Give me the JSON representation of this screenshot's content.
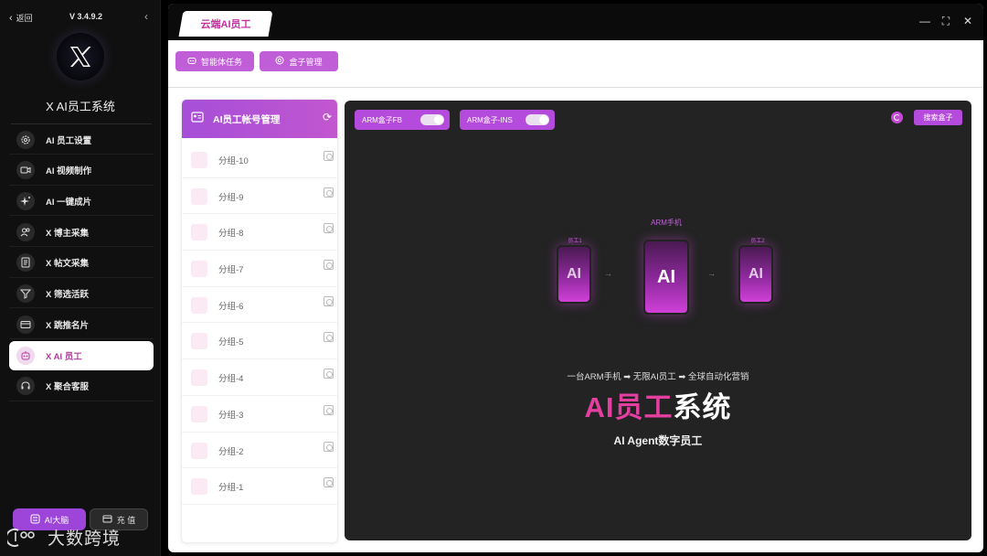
{
  "sidebar": {
    "back_label": "返回",
    "version": "V 3.4.9.2",
    "app_title": "X AI员工系统",
    "menu": [
      {
        "label": "AI 员工设置",
        "icon": "gear-icon"
      },
      {
        "label": "AI 视频制作",
        "icon": "video-icon"
      },
      {
        "label": "AI 一键成片",
        "icon": "sparkle-icon"
      },
      {
        "label": "X 博主采集",
        "icon": "users-icon"
      },
      {
        "label": "X 帖文采集",
        "icon": "document-icon"
      },
      {
        "label": "X 筛选活跃",
        "icon": "filter-icon"
      },
      {
        "label": "X 跳推名片",
        "icon": "card-icon"
      },
      {
        "label": "X AI 员工",
        "icon": "robot-icon",
        "active": true
      },
      {
        "label": "X 聚合客服",
        "icon": "headset-icon"
      }
    ],
    "ai_brain_button": "AI大脑",
    "recharge_button": "充 值",
    "watermark_text": "大数跨境"
  },
  "window": {
    "tab_label": "云端AI员工",
    "controls": [
      "—",
      "⛶",
      "✕"
    ]
  },
  "toolbar": {
    "agent_task_button": "智能体任务",
    "box_manage_button": "盒子管理"
  },
  "group_panel": {
    "title": "AI员工帐号管理",
    "groups": [
      "分组-10",
      "分组-9",
      "分组-8",
      "分组-7",
      "分组-6",
      "分组-5",
      "分组-4",
      "分组-3",
      "分组-2",
      "分组-1"
    ]
  },
  "content": {
    "box_toggles": [
      {
        "label": "ARM盒子FB",
        "on": true
      },
      {
        "label": "ARM盒子-INS",
        "on": true
      }
    ],
    "search_box_button": "搜索盒子",
    "center_phone_label": "ARM手机",
    "side_phone_left_label": "员工1",
    "side_phone_right_label": "员工2",
    "phone_text": "AI",
    "slogan": "一台ARM手机 ➡ 无限AI员工 ➡ 全球自动化营销",
    "title_highlight": "AI员工",
    "title_rest": "系统",
    "subtitle": "AI Agent数字员工"
  },
  "colors": {
    "accent": "#b54bdc",
    "highlight_pink": "#e33ea0",
    "active_text": "#b0409c"
  }
}
